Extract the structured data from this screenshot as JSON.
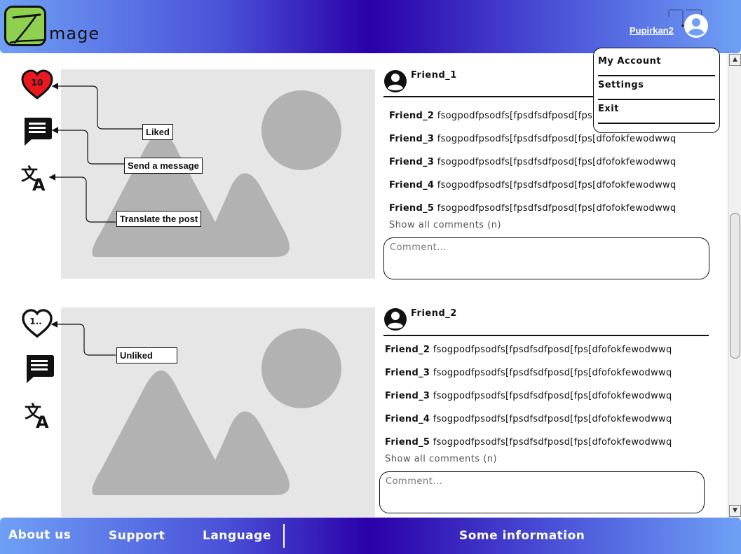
{
  "header": {
    "logo_text": "mage",
    "username": "Pupirkan2"
  },
  "account_menu": {
    "items": [
      {
        "label": "My Account"
      },
      {
        "label": "Settings"
      },
      {
        "label": "Exit"
      }
    ]
  },
  "posts": [
    {
      "like_count": "10",
      "liked": true,
      "callouts": {
        "like": "Liked",
        "message": "Send a message",
        "translate": "Translate the post"
      },
      "author": "Friend_1",
      "comments": [
        {
          "who": "Friend_2",
          "text": "fsogpodfpsodfs[fpsdfsdfposd[fps[dfofokfewodwwq"
        },
        {
          "who": "Friend_3",
          "text": "fsogpodfpsodfs[fpsdfsdfposd[fps[dfofokfewodwwq"
        },
        {
          "who": "Friend_3",
          "text": "fsogpodfpsodfs[fpsdfsdfposd[fps[dfofokfewodwwq"
        },
        {
          "who": "Friend_4",
          "text": "fsogpodfpsodfs[fpsdfsdfposd[fps[dfofokfewodwwq"
        },
        {
          "who": "Friend_5",
          "text": "fsogpodfpsodfs[fpsdfsdfposd[fps[dfofokfewodwwq"
        }
      ],
      "show_all": "Show all comments (n)",
      "comment_placeholder": "Comment..."
    },
    {
      "like_count": "1..",
      "liked": false,
      "callouts": {
        "like": "Unliked"
      },
      "author": "Friend_2",
      "comments": [
        {
          "who": "Friend_2",
          "text": "fsogpodfpsodfs[fpsdfsdfposd[fps[dfofokfewodwwq"
        },
        {
          "who": "Friend_3",
          "text": "fsogpodfpsodfs[fpsdfsdfposd[fps[dfofokfewodwwq"
        },
        {
          "who": "Friend_3",
          "text": "fsogpodfpsodfs[fpsdfsdfposd[fps[dfofokfewodwwq"
        },
        {
          "who": "Friend_4",
          "text": "fsogpodfpsodfs[fpsdfsdfposd[fps[dfofokfewodwwq"
        },
        {
          "who": "Friend_5",
          "text": "fsogpodfpsodfs[fpsdfsdfposd[fps[dfofokfewodwwq"
        }
      ],
      "show_all": "Show all comments (n)",
      "comment_placeholder": "Comment..."
    }
  ],
  "footer": {
    "links": [
      {
        "label": "About us"
      },
      {
        "label": "Support"
      },
      {
        "label": "Language"
      },
      {
        "label": "Some information"
      }
    ]
  },
  "colors": {
    "header_gradient_center": "#2a00a8",
    "header_gradient_edge": "#6fa0f5",
    "like_red": "#e8191e",
    "logo_green": "#8fd14f",
    "placeholder_gray": "#b2b2b2",
    "image_bg": "#e6e6e6"
  },
  "icons": [
    "logo-icon",
    "user-avatar-icon",
    "heart-icon",
    "message-icon",
    "translate-icon",
    "image-placeholder-icon"
  ]
}
